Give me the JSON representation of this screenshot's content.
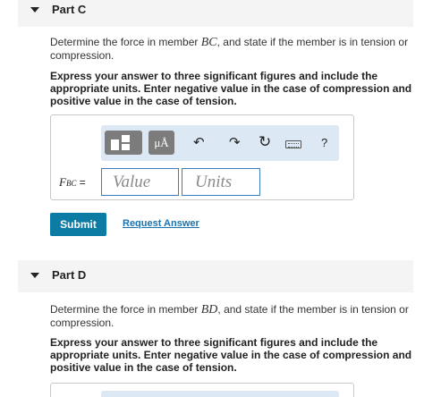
{
  "part_c": {
    "title": "Part C",
    "question_before": "Determine the force in member ",
    "member": "BC",
    "question_after": ", and state if the member is in tension or compression.",
    "instructions": "Express your answer to three significant figures and include the appropriate units. Enter negative value in the case of compression and positive value in the case of tension.",
    "answer": {
      "label_symbol": "F",
      "label_subscript": "BC",
      "label_suffix": " =",
      "value_placeholder": "Value",
      "units_placeholder": "Units"
    },
    "toolbar": {
      "units_label": "μÅ",
      "help_label": "?",
      "icons": [
        "templates-icon",
        "units-icon",
        "undo-icon",
        "redo-icon",
        "reset-icon",
        "keyboard-icon",
        "help-icon"
      ]
    },
    "submit_label": "Submit",
    "request_label": "Request Answer"
  },
  "part_d": {
    "title": "Part D",
    "question_before": "Determine the force in member ",
    "member": "BD",
    "question_after": ", and state if the member is in tension or compression.",
    "instructions": "Express your answer to three significant figures and include the appropriate units. Enter negative value in the case of compression and positive value in the case of tension."
  },
  "colors": {
    "header_bg": "#f4f4f4",
    "toolbar_bg": "#dce8f4",
    "submit_bg": "#0d7ca5",
    "link": "#1a73b0",
    "field_border": "#3d7bc2"
  }
}
